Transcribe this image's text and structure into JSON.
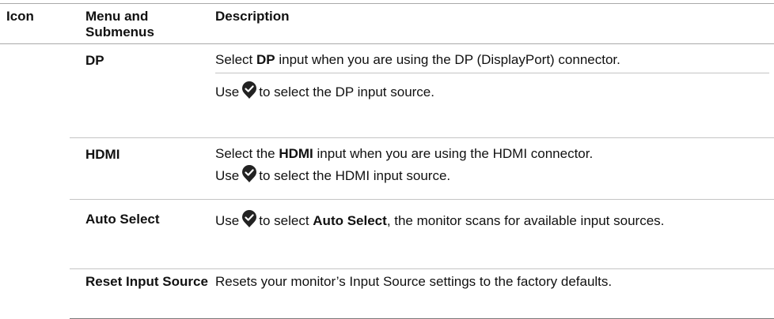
{
  "table": {
    "headers": {
      "icon": "Icon",
      "menu": "Menu and Submenus",
      "description": "Description"
    },
    "rows": [
      {
        "menu": "DP",
        "p1": {
          "t1": "Select ",
          "b1": "DP",
          "t2": " input when you are using the DP (DisplayPort) connector."
        },
        "p2": {
          "t1": "Use",
          "t2": "to select the DP input source."
        }
      },
      {
        "menu": "HDMI",
        "p1": {
          "t1": "Select the ",
          "b1": "HDMI",
          "t2": " input when you are using the HDMI connector."
        },
        "p2": {
          "t1": "Use",
          "t2": "to select the HDMI input source."
        }
      },
      {
        "menu": "Auto Select",
        "p1": {
          "t1": "Use",
          "t2": "to select ",
          "b1": "Auto Select",
          "t3": ", the monitor scans for available input sources."
        }
      },
      {
        "menu": "Reset Input Source",
        "p1": {
          "t1": "Resets your monitor’s Input Source settings to the factory defaults."
        }
      }
    ]
  },
  "icons": {
    "confirm": "checkmark-pin-icon",
    "color": "#222222",
    "mark_color": "#ffffff"
  }
}
